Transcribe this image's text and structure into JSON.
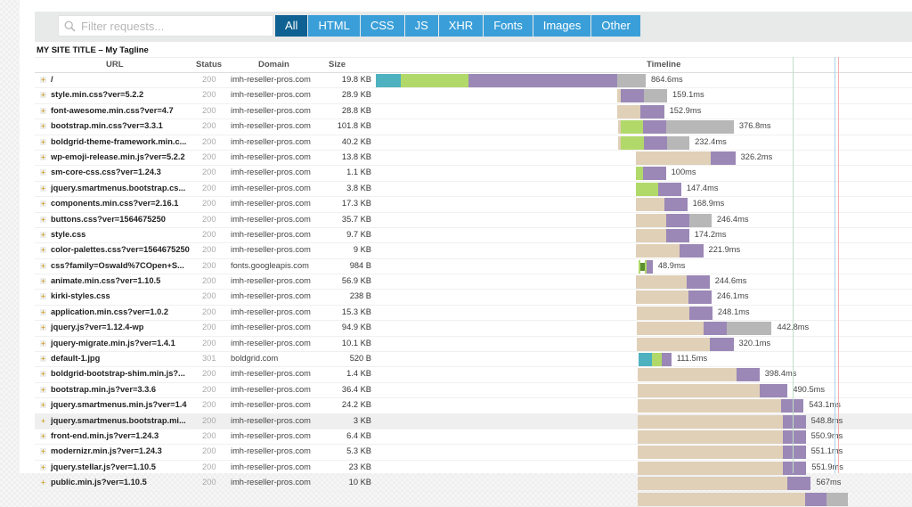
{
  "search": {
    "placeholder": "Filter requests...",
    "value": ""
  },
  "filters": [
    {
      "label": "All",
      "active": true
    },
    {
      "label": "HTML",
      "active": false
    },
    {
      "label": "CSS",
      "active": false
    },
    {
      "label": "JS",
      "active": false
    },
    {
      "label": "XHR",
      "active": false
    },
    {
      "label": "Fonts",
      "active": false
    },
    {
      "label": "Images",
      "active": false
    },
    {
      "label": "Other",
      "active": false
    }
  ],
  "site_title": "MY SITE TITLE – My Tagline",
  "columns": {
    "url": "URL",
    "status": "Status",
    "domain": "Domain",
    "size": "Size",
    "timeline": "Timeline"
  },
  "colors": {
    "blocking": "#e0d0b8",
    "dns": "#4eb1c0",
    "connect": "#b1d96a",
    "wait": "#9b88b6",
    "receive": "#b7b7b7",
    "ssl": "#5a8f2e"
  },
  "markers_ms": {
    "dom_content_loaded": 1426,
    "onload_blue": 1564,
    "onload_red": 1576
  },
  "rows": [
    {
      "url": "/",
      "status": "200",
      "domain": "imh-reseller-pros.com",
      "size": "19.8 KB",
      "duration": "864.6ms",
      "start": 0,
      "segs": [
        [
          "dns",
          82
        ],
        [
          "connect",
          222
        ],
        [
          "wait",
          486
        ],
        [
          "receive",
          92
        ]
      ]
    },
    {
      "url": "style.min.css?ver=5.2.2",
      "status": "200",
      "domain": "imh-reseller-pros.com",
      "size": "28.9 KB",
      "duration": "159.1ms",
      "start": 788,
      "segs": [
        [
          "blocking",
          12
        ],
        [
          "wait",
          76
        ],
        [
          "receive",
          76
        ]
      ]
    },
    {
      "url": "font-awesome.min.css?ver=4.7",
      "status": "200",
      "domain": "imh-reseller-pros.com",
      "size": "28.8 KB",
      "duration": "152.9ms",
      "start": 788,
      "segs": [
        [
          "blocking",
          78
        ],
        [
          "wait",
          76
        ]
      ]
    },
    {
      "url": "bootstrap.min.css?ver=3.3.1",
      "status": "200",
      "domain": "imh-reseller-pros.com",
      "size": "101.8 KB",
      "duration": "376.8ms",
      "start": 791,
      "segs": [
        [
          "blocking",
          9
        ],
        [
          "connect",
          73
        ],
        [
          "wait",
          76
        ],
        [
          "receive",
          221
        ]
      ]
    },
    {
      "url": "boldgrid-theme-framework.min.c...",
      "status": "200",
      "domain": "imh-reseller-pros.com",
      "size": "40.2 KB",
      "duration": "232.4ms",
      "start": 791,
      "segs": [
        [
          "blocking",
          9
        ],
        [
          "connect",
          76
        ],
        [
          "wait",
          76
        ],
        [
          "receive",
          73
        ]
      ]
    },
    {
      "url": "wp-emoji-release.min.js?ver=5.2.2",
      "status": "200",
      "domain": "imh-reseller-pros.com",
      "size": "13.8 KB",
      "duration": "326.2ms",
      "start": 849,
      "segs": [
        [
          "blocking",
          247
        ],
        [
          "wait",
          79
        ]
      ]
    },
    {
      "url": "sm-core-css.css?ver=1.24.3",
      "status": "200",
      "domain": "imh-reseller-pros.com",
      "size": "1.1 KB",
      "duration": "100ms",
      "start": 849,
      "segs": [
        [
          "connect",
          23
        ],
        [
          "wait",
          76
        ]
      ]
    },
    {
      "url": "jquery.smartmenus.bootstrap.cs...",
      "status": "200",
      "domain": "imh-reseller-pros.com",
      "size": "3.8 KB",
      "duration": "147.4ms",
      "start": 849,
      "segs": [
        [
          "connect",
          73
        ],
        [
          "wait",
          76
        ]
      ]
    },
    {
      "url": "components.min.css?ver=2.16.1",
      "status": "200",
      "domain": "imh-reseller-pros.com",
      "size": "17.3 KB",
      "duration": "168.9ms",
      "start": 849,
      "segs": [
        [
          "blocking",
          93
        ],
        [
          "wait",
          76
        ]
      ]
    },
    {
      "url": "buttons.css?ver=1564675250",
      "status": "200",
      "domain": "imh-reseller-pros.com",
      "size": "35.7 KB",
      "duration": "246.4ms",
      "start": 849,
      "segs": [
        [
          "blocking",
          99
        ],
        [
          "wait",
          76
        ],
        [
          "receive",
          73
        ]
      ]
    },
    {
      "url": "style.css",
      "status": "200",
      "domain": "imh-reseller-pros.com",
      "size": "9.7 KB",
      "duration": "174.2ms",
      "start": 849,
      "segs": [
        [
          "blocking",
          99
        ],
        [
          "wait",
          76
        ]
      ]
    },
    {
      "url": "color-palettes.css?ver=1564675250",
      "status": "200",
      "domain": "imh-reseller-pros.com",
      "size": "9 KB",
      "duration": "221.9ms",
      "start": 849,
      "segs": [
        [
          "blocking",
          145
        ],
        [
          "wait",
          76
        ]
      ]
    },
    {
      "url": "css?family=Oswald%7COpen+S...",
      "status": "200",
      "domain": "fonts.googleapis.com",
      "size": "984 B",
      "duration": "48.9ms",
      "start": 858,
      "segs": [
        [
          "connect",
          6
        ],
        [
          "ssl",
          15
        ],
        [
          "connect",
          6
        ],
        [
          "wait",
          20
        ]
      ]
    },
    {
      "url": "animate.min.css?ver=1.10.5",
      "status": "200",
      "domain": "imh-reseller-pros.com",
      "size": "56.9 KB",
      "duration": "244.6ms",
      "start": 849,
      "segs": [
        [
          "blocking",
          166
        ],
        [
          "wait",
          76
        ]
      ]
    },
    {
      "url": "kirki-styles.css",
      "status": "200",
      "domain": "imh-reseller-pros.com",
      "size": "238 B",
      "duration": "246.1ms",
      "start": 849,
      "segs": [
        [
          "blocking",
          172
        ],
        [
          "wait",
          76
        ]
      ]
    },
    {
      "url": "application.min.css?ver=1.0.2",
      "status": "200",
      "domain": "imh-reseller-pros.com",
      "size": "15.3 KB",
      "duration": "248.1ms",
      "start": 852,
      "segs": [
        [
          "blocking",
          172
        ],
        [
          "wait",
          76
        ]
      ]
    },
    {
      "url": "jquery.js?ver=1.12.4-wp",
      "status": "200",
      "domain": "imh-reseller-pros.com",
      "size": "94.9 KB",
      "duration": "442.8ms",
      "start": 852,
      "segs": [
        [
          "blocking",
          218
        ],
        [
          "wait",
          76
        ],
        [
          "receive",
          148
        ]
      ]
    },
    {
      "url": "jquery-migrate.min.js?ver=1.4.1",
      "status": "200",
      "domain": "imh-reseller-pros.com",
      "size": "10.1 KB",
      "duration": "320.1ms",
      "start": 852,
      "segs": [
        [
          "blocking",
          241
        ],
        [
          "wait",
          76
        ]
      ]
    },
    {
      "url": "default-1.jpg",
      "status": "301",
      "domain": "boldgrid.com",
      "size": "520 B",
      "duration": "111.5ms",
      "start": 858,
      "segs": [
        [
          "dns",
          44
        ],
        [
          "connect",
          32
        ],
        [
          "wait",
          32
        ]
      ]
    },
    {
      "url": "boldgrid-bootstrap-shim.min.js?...",
      "status": "200",
      "domain": "imh-reseller-pros.com",
      "size": "1.4 KB",
      "duration": "398.4ms",
      "start": 855,
      "segs": [
        [
          "blocking",
          323
        ],
        [
          "wait",
          76
        ]
      ]
    },
    {
      "url": "bootstrap.min.js?ver=3.3.6",
      "status": "200",
      "domain": "imh-reseller-pros.com",
      "size": "36.4 KB",
      "duration": "490.5ms",
      "start": 855,
      "segs": [
        [
          "blocking",
          401
        ],
        [
          "wait",
          90
        ]
      ]
    },
    {
      "url": "jquery.smartmenus.min.js?ver=1.4",
      "status": "200",
      "domain": "imh-reseller-pros.com",
      "size": "24.2 KB",
      "duration": "543.1ms",
      "start": 855,
      "segs": [
        [
          "blocking",
          470
        ],
        [
          "wait",
          73
        ]
      ]
    },
    {
      "url": "jquery.smartmenus.bootstrap.mi...",
      "status": "200",
      "domain": "imh-reseller-pros.com",
      "size": "3 KB",
      "duration": "548.8ms",
      "start": 855,
      "segs": [
        [
          "blocking",
          474
        ],
        [
          "wait",
          76
        ]
      ],
      "highlight": true
    },
    {
      "url": "front-end.min.js?ver=1.24.3",
      "status": "200",
      "domain": "imh-reseller-pros.com",
      "size": "6.4 KB",
      "duration": "550.9ms",
      "start": 855,
      "segs": [
        [
          "blocking",
          474
        ],
        [
          "wait",
          76
        ]
      ]
    },
    {
      "url": "modernizr.min.js?ver=1.24.3",
      "status": "200",
      "domain": "imh-reseller-pros.com",
      "size": "5.3 KB",
      "duration": "551.1ms",
      "start": 855,
      "segs": [
        [
          "blocking",
          474
        ],
        [
          "wait",
          76
        ]
      ]
    },
    {
      "url": "jquery.stellar.js?ver=1.10.5",
      "status": "200",
      "domain": "imh-reseller-pros.com",
      "size": "23 KB",
      "duration": "551.9ms",
      "start": 855,
      "segs": [
        [
          "blocking",
          474
        ],
        [
          "wait",
          78
        ]
      ]
    },
    {
      "url": "public.min.js?ver=1.10.5",
      "status": "200",
      "domain": "imh-reseller-pros.com",
      "size": "10 KB",
      "duration": "567ms",
      "start": 855,
      "segs": [
        [
          "blocking",
          491
        ],
        [
          "wait",
          76
        ]
      ]
    },
    {
      "url": "",
      "status": "",
      "domain": "",
      "size": "",
      "duration": "",
      "start": 855,
      "segs": [
        [
          "blocking",
          547
        ],
        [
          "wait",
          70
        ],
        [
          "receive",
          70
        ]
      ]
    }
  ]
}
